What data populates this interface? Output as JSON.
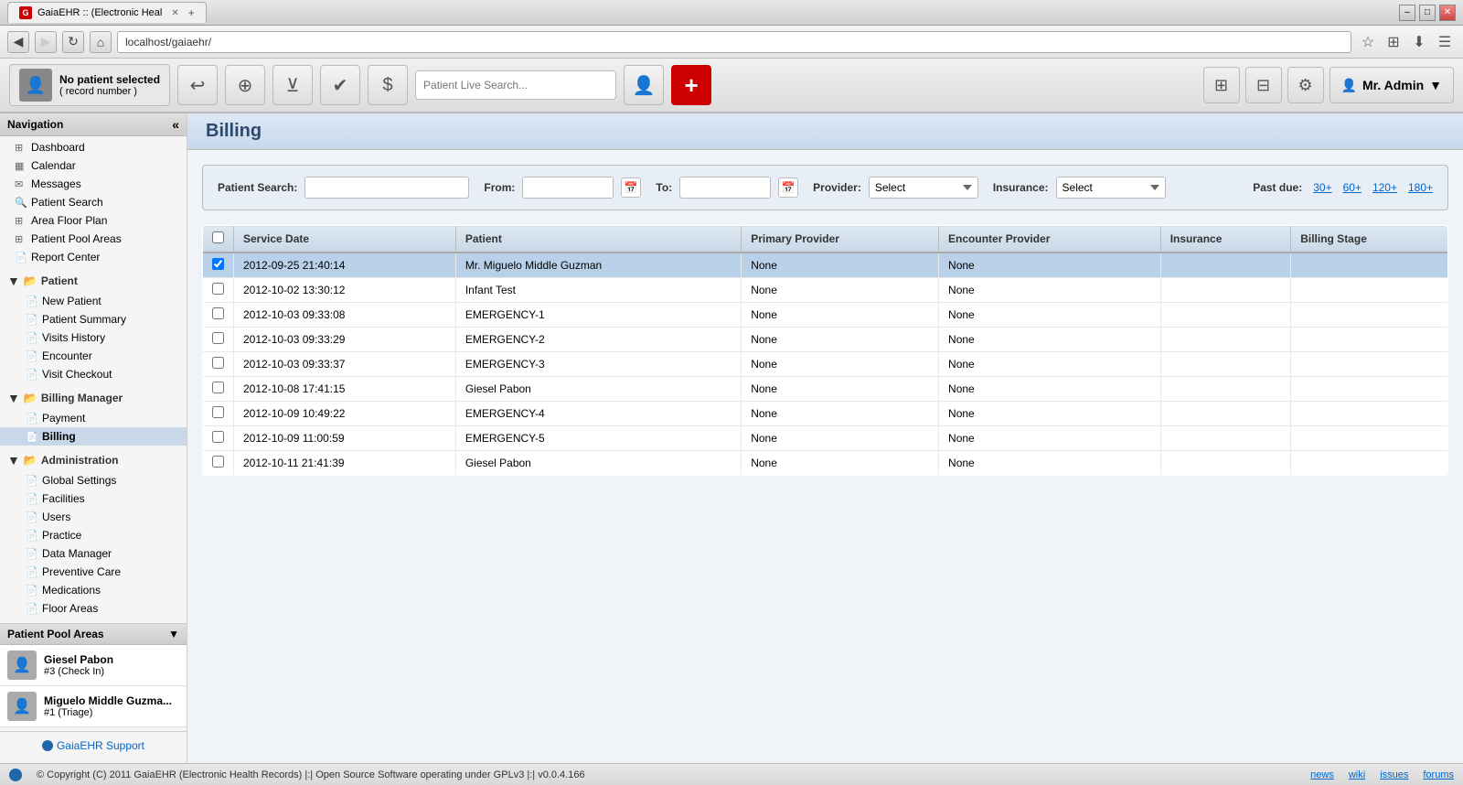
{
  "browser": {
    "tab_title": "GaiaEHR :: (Electronic Heal",
    "address": "localhost/gaiaehr/",
    "window_controls": [
      "–",
      "□",
      "✕"
    ]
  },
  "app_toolbar": {
    "patient_label": "No patient selected",
    "patient_sub": "( record number )",
    "search_placeholder": "Patient Live Search...",
    "admin_user": "Mr. Admin"
  },
  "sidebar": {
    "title": "Navigation",
    "collapse_icon": "«",
    "items": [
      {
        "id": "dashboard",
        "label": "Dashboard",
        "icon": "⊞",
        "level": 1
      },
      {
        "id": "calendar",
        "label": "Calendar",
        "icon": "▦",
        "level": 1
      },
      {
        "id": "messages",
        "label": "Messages",
        "icon": "✉",
        "level": 1
      },
      {
        "id": "patient-search",
        "label": "Patient Search",
        "icon": "🔍",
        "level": 1
      },
      {
        "id": "area-floor-plan",
        "label": "Area Floor Plan",
        "icon": "⊞",
        "level": 1
      },
      {
        "id": "patient-pool-areas",
        "label": "Patient Pool Areas",
        "icon": "⊞",
        "level": 1
      },
      {
        "id": "report-center",
        "label": "Report Center",
        "icon": "📄",
        "level": 1
      }
    ],
    "groups": [
      {
        "id": "patient",
        "label": "Patient",
        "icon": "📁",
        "items": [
          {
            "id": "new-patient",
            "label": "New Patient"
          },
          {
            "id": "patient-summary",
            "label": "Patient Summary"
          },
          {
            "id": "visits-history",
            "label": "Visits History"
          },
          {
            "id": "encounter",
            "label": "Encounter"
          },
          {
            "id": "visit-checkout",
            "label": "Visit Checkout"
          }
        ]
      },
      {
        "id": "billing-manager",
        "label": "Billing Manager",
        "icon": "📁",
        "items": [
          {
            "id": "payment",
            "label": "Payment"
          },
          {
            "id": "billing",
            "label": "Billing",
            "active": true
          }
        ]
      },
      {
        "id": "administration",
        "label": "Administration",
        "icon": "📁",
        "items": [
          {
            "id": "global-settings",
            "label": "Global Settings"
          },
          {
            "id": "facilities",
            "label": "Facilities"
          },
          {
            "id": "users",
            "label": "Users"
          },
          {
            "id": "practice",
            "label": "Practice"
          },
          {
            "id": "data-manager",
            "label": "Data Manager"
          },
          {
            "id": "preventive-care",
            "label": "Preventive Care"
          },
          {
            "id": "medications",
            "label": "Medications"
          },
          {
            "id": "floor-areas",
            "label": "Floor Areas"
          }
        ]
      }
    ],
    "pool": {
      "title": "Patient Pool Areas",
      "patients": [
        {
          "name": "Giesel Pabon",
          "info": "#3 (Check In)"
        },
        {
          "name": "Miguelo Middle Guzma...",
          "info": "#1 (Triage)"
        }
      ]
    }
  },
  "page": {
    "title": "Billing"
  },
  "billing": {
    "search_label": "Patient Search:",
    "from_label": "From:",
    "to_label": "To:",
    "provider_label": "Provider:",
    "insurance_label": "Insurance:",
    "provider_placeholder": "Select",
    "insurance_placeholder": "Select",
    "past_due_label": "Past due:",
    "past_due_30": "30+",
    "past_due_60": "60+",
    "past_due_120": "120+",
    "past_due_180": "180+",
    "columns": [
      {
        "id": "service-date",
        "label": "Service Date"
      },
      {
        "id": "patient",
        "label": "Patient"
      },
      {
        "id": "primary-provider",
        "label": "Primary Provider"
      },
      {
        "id": "encounter-provider",
        "label": "Encounter Provider"
      },
      {
        "id": "insurance",
        "label": "Insurance"
      },
      {
        "id": "billing-stage",
        "label": "Billing Stage"
      }
    ],
    "rows": [
      {
        "id": 1,
        "service_date": "2012-09-25 21:40:14",
        "patient": "Mr. Miguelo Middle Guzman",
        "primary_provider": "None",
        "encounter_provider": "None",
        "insurance": "",
        "billing_stage": "",
        "selected": true
      },
      {
        "id": 2,
        "service_date": "2012-10-02 13:30:12",
        "patient": "Infant Test",
        "primary_provider": "None",
        "encounter_provider": "None",
        "insurance": "",
        "billing_stage": "",
        "selected": false
      },
      {
        "id": 3,
        "service_date": "2012-10-03 09:33:08",
        "patient": "EMERGENCY-1",
        "primary_provider": "None",
        "encounter_provider": "None",
        "insurance": "",
        "billing_stage": "",
        "selected": false
      },
      {
        "id": 4,
        "service_date": "2012-10-03 09:33:29",
        "patient": "EMERGENCY-2",
        "primary_provider": "None",
        "encounter_provider": "None",
        "insurance": "",
        "billing_stage": "",
        "selected": false
      },
      {
        "id": 5,
        "service_date": "2012-10-03 09:33:37",
        "patient": "EMERGENCY-3",
        "primary_provider": "None",
        "encounter_provider": "None",
        "insurance": "",
        "billing_stage": "",
        "selected": false
      },
      {
        "id": 6,
        "service_date": "2012-10-08 17:41:15",
        "patient": "Giesel Pabon",
        "primary_provider": "None",
        "encounter_provider": "None",
        "insurance": "",
        "billing_stage": "",
        "selected": false
      },
      {
        "id": 7,
        "service_date": "2012-10-09 10:49:22",
        "patient": "EMERGENCY-4",
        "primary_provider": "None",
        "encounter_provider": "None",
        "insurance": "",
        "billing_stage": "",
        "selected": false
      },
      {
        "id": 8,
        "service_date": "2012-10-09 11:00:59",
        "patient": "EMERGENCY-5",
        "primary_provider": "None",
        "encounter_provider": "None",
        "insurance": "",
        "billing_stage": "",
        "selected": false
      },
      {
        "id": 9,
        "service_date": "2012-10-11 21:41:39",
        "patient": "Giesel Pabon",
        "primary_provider": "None",
        "encounter_provider": "None",
        "insurance": "",
        "billing_stage": "",
        "selected": false
      }
    ]
  },
  "status_bar": {
    "copyright": "© Copyright (C) 2011 GaiaEHR (Electronic Health Records) |:| Open Source Software operating under GPLv3 |:| v0.0.4.166",
    "support_label": "GaiaEHR Support",
    "links": [
      "news",
      "wiki",
      "issues",
      "forums"
    ]
  }
}
